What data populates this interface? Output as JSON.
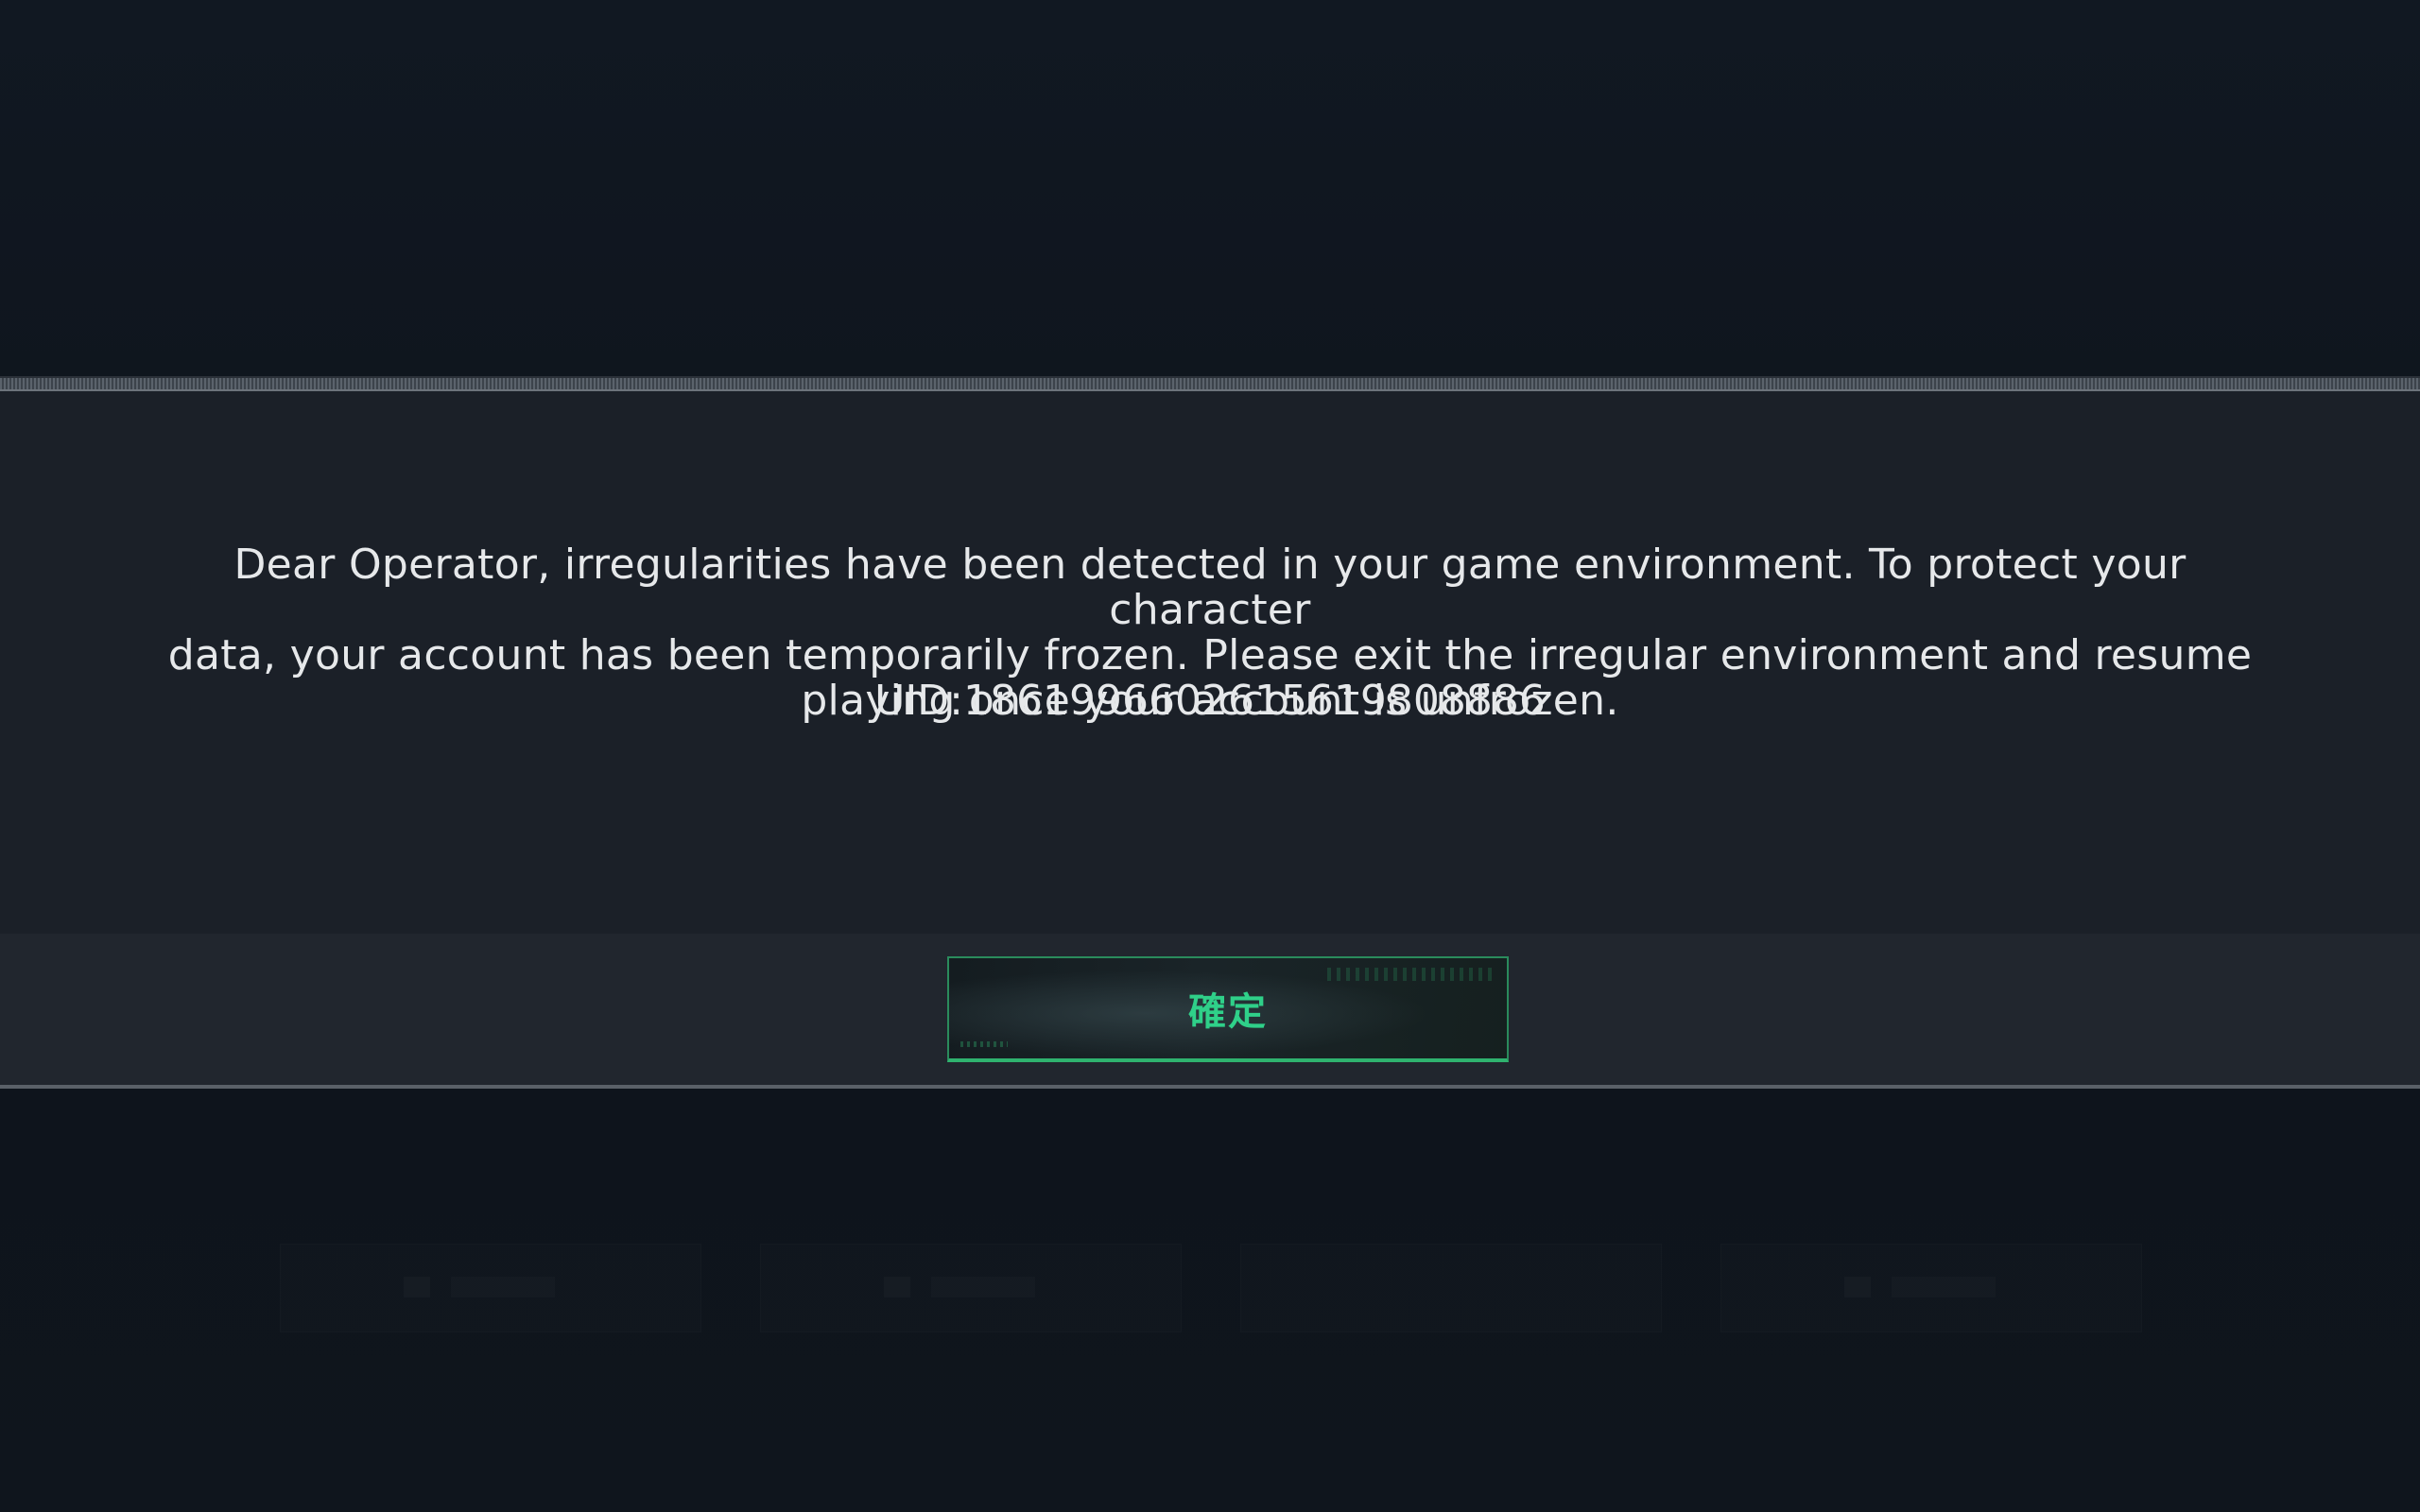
{
  "dialog": {
    "message": "Dear Operator, irregularities have been detected in your game environment. To protect your character\ndata, your account has been temporarily frozen. Please exit the irregular environment and resume\nplaying once your account is unfrozen.",
    "uid": "UID:1861996602615619808886",
    "confirm_label": "確定"
  },
  "colors": {
    "accent": "#2fd089",
    "background": "#0f151d",
    "dialog_body": "#1b2028",
    "text": "#e6e8ea"
  },
  "icons": {
    "background_hex": "hexagon-icon"
  }
}
